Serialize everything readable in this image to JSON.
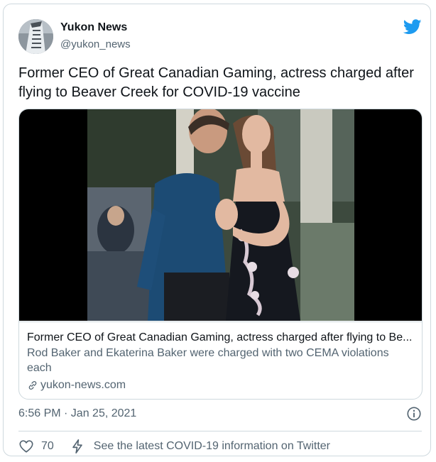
{
  "author": {
    "name": "Yukon News",
    "handle": "@yukon_news"
  },
  "tweet": {
    "text": "Former CEO of Great Canadian Gaming, actress charged after flying to Beaver Creek for COVID-19 vaccine"
  },
  "link_card": {
    "title": "Former CEO of Great Canadian Gaming, actress charged after flying to Be...",
    "description": "Rod Baker and Ekaterina Baker were charged with two CEMA violations each",
    "domain": "yukon-news.com"
  },
  "timestamp": "6:56 PM · Jan 25, 2021",
  "actions": {
    "like_count": "70",
    "covid_link": "See the latest COVID-19 information on Twitter"
  },
  "colors": {
    "twitter_blue": "#1d9bf0",
    "secondary_text": "#536471",
    "border": "#cfd9de"
  },
  "icons": [
    "twitter-bird-icon",
    "link-icon",
    "info-icon",
    "heart-icon",
    "lightning-icon"
  ]
}
